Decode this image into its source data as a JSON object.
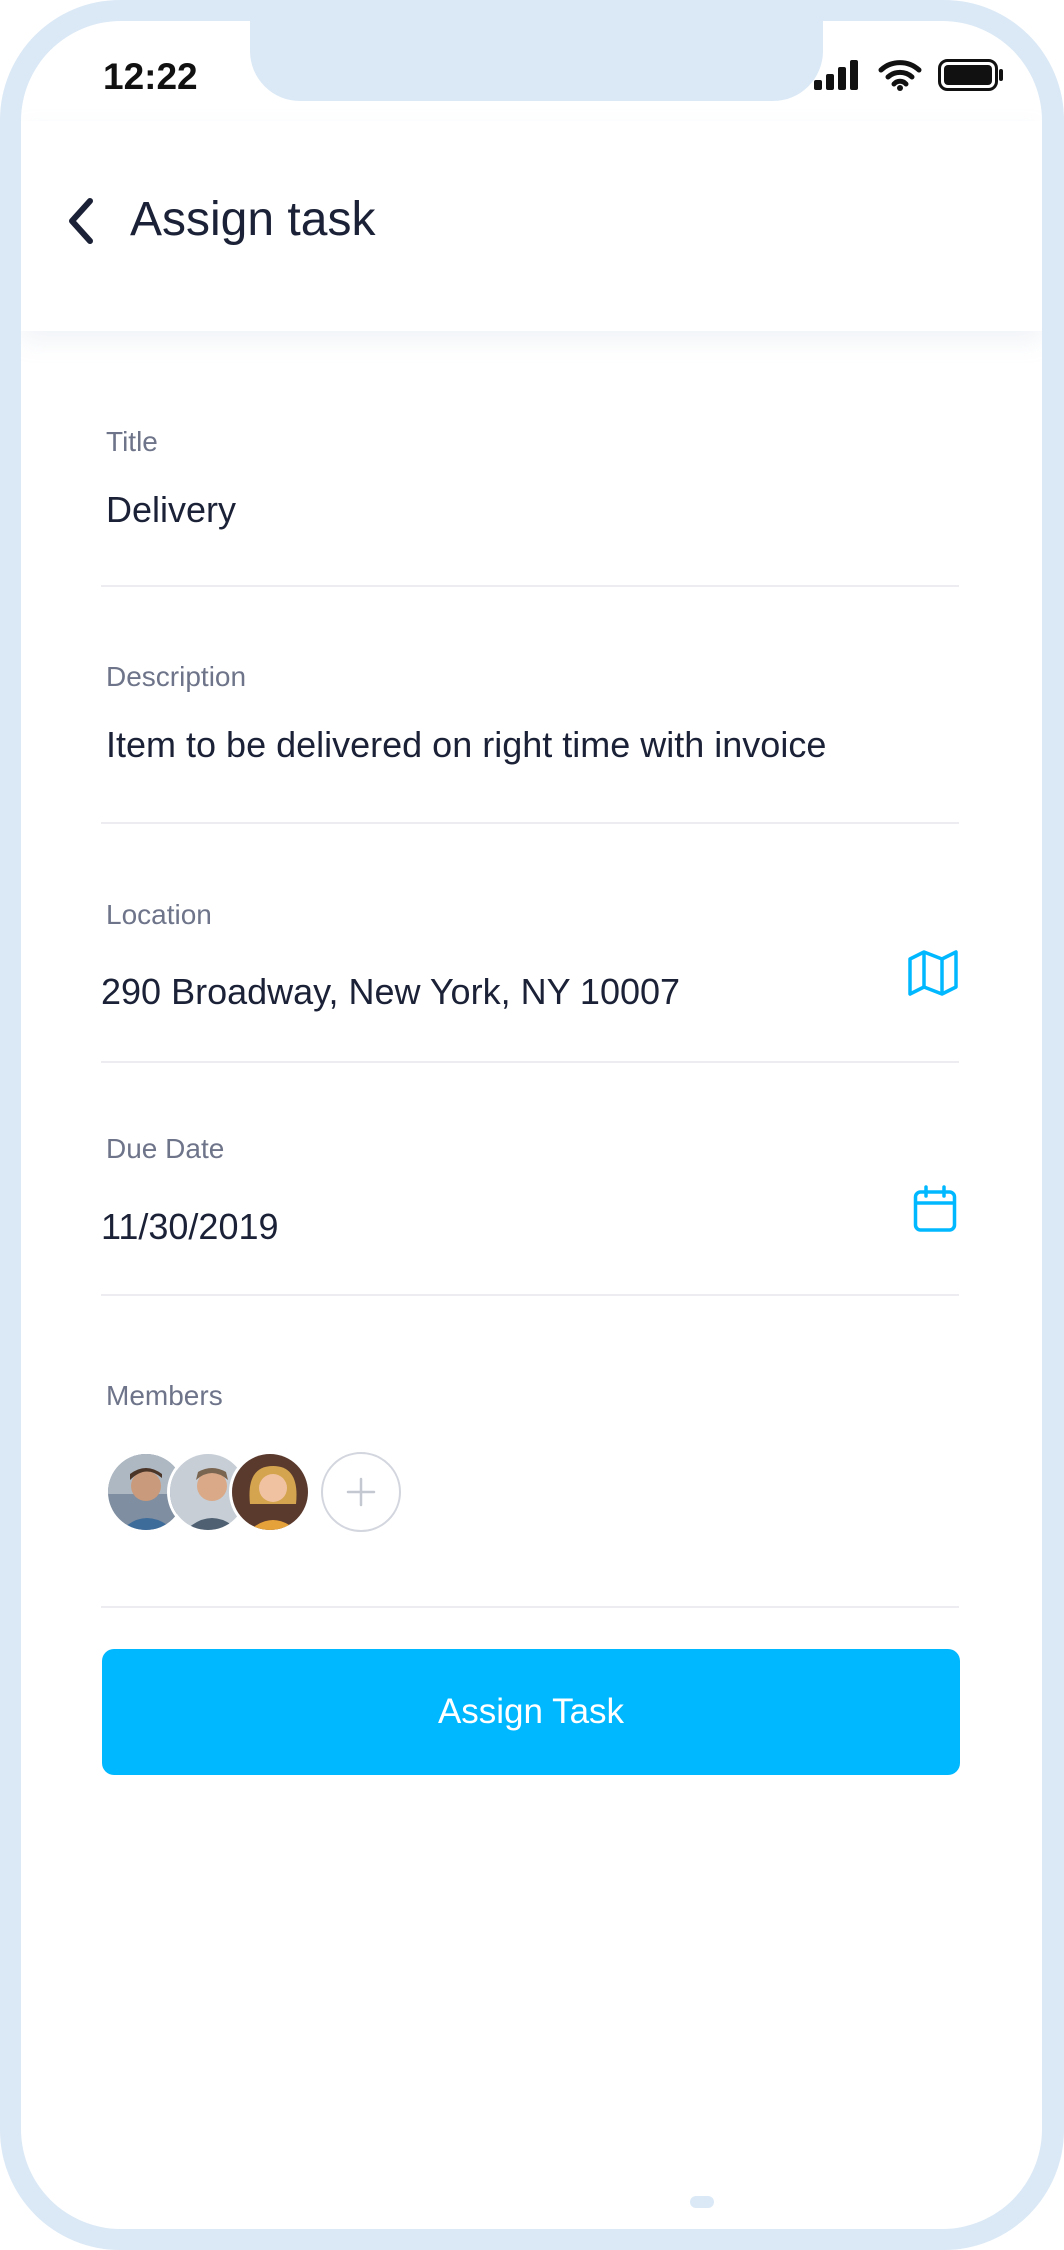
{
  "status_bar": {
    "time": "12:22"
  },
  "header": {
    "title": "Assign task",
    "back_icon": "chevron-left-icon"
  },
  "form": {
    "title": {
      "label": "Title",
      "value": "Delivery"
    },
    "description": {
      "label": "Description",
      "value": "Item to be delivered on right time with invoice"
    },
    "location": {
      "label": "Location",
      "value": "290 Broadway, New York, NY 10007",
      "icon": "map-icon"
    },
    "due_date": {
      "label": "Due Date",
      "value": "11/30/2019",
      "icon": "calendar-icon"
    },
    "members": {
      "label": "Members",
      "count": 3,
      "add_icon": "plus-icon"
    }
  },
  "actions": {
    "assign_label": "Assign Task"
  },
  "colors": {
    "accent": "#00b8ff",
    "frame": "#dbe9f6",
    "text_primary": "#1b2136",
    "text_secondary": "#6e7489",
    "divider": "#ececf1"
  }
}
